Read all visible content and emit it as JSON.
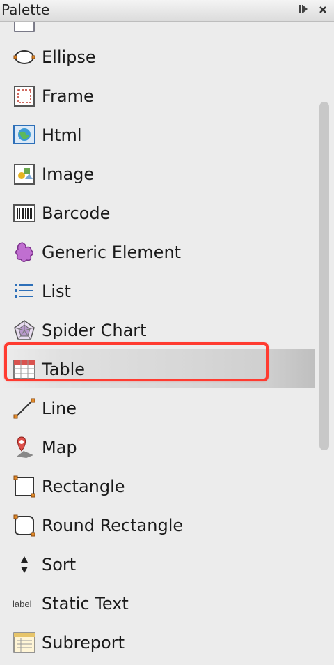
{
  "panel": {
    "title": "Palette"
  },
  "items": [
    {
      "label": "Ellipse",
      "icon": "ellipse-icon"
    },
    {
      "label": "Frame",
      "icon": "frame-icon"
    },
    {
      "label": "Html",
      "icon": "html-icon"
    },
    {
      "label": "Image",
      "icon": "image-icon"
    },
    {
      "label": "Barcode",
      "icon": "barcode-icon"
    },
    {
      "label": "Generic Element",
      "icon": "generic-element-icon"
    },
    {
      "label": "List",
      "icon": "list-icon"
    },
    {
      "label": "Spider Chart",
      "icon": "spider-chart-icon"
    },
    {
      "label": "Table",
      "icon": "table-icon",
      "selected": true
    },
    {
      "label": "Line",
      "icon": "line-icon"
    },
    {
      "label": "Map",
      "icon": "map-icon"
    },
    {
      "label": "Rectangle",
      "icon": "rectangle-icon"
    },
    {
      "label": "Round Rectangle",
      "icon": "round-rectangle-icon"
    },
    {
      "label": "Sort",
      "icon": "sort-icon"
    },
    {
      "label": "Static Text",
      "icon": "static-text-icon"
    },
    {
      "label": "Subreport",
      "icon": "subreport-icon"
    }
  ],
  "colors": {
    "highlight": "#ff3b30",
    "background": "#ececec"
  }
}
